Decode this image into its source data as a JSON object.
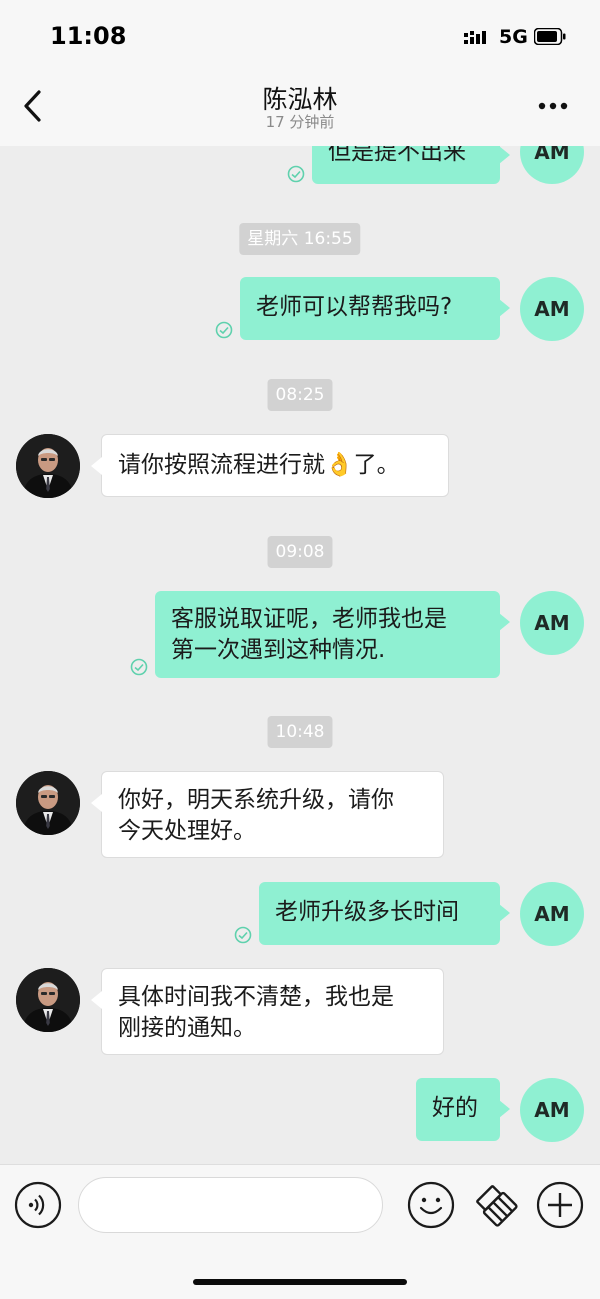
{
  "status_bar": {
    "time": "11:08",
    "network": "5G"
  },
  "header": {
    "title": "陈泓林",
    "subtitle": "17 分钟前"
  },
  "me_avatar_text": "AM",
  "messages": {
    "m0": "但是提不出来",
    "t1": "星期六 16:55",
    "m1": "老师可以帮帮我吗?",
    "t2": "08:25",
    "m2a": "请你按照流程进行就",
    "m2emoji": "👌",
    "m2b": "了。",
    "t3": "09:08",
    "m3l1": "客服说取证呢，老师我也是",
    "m3l2": "第一次遇到这种情况.",
    "t4": "10:48",
    "m4l1": "你好，明天系统升级，请你",
    "m4l2": "今天处理好。",
    "m5": "老师升级多长时间",
    "m6l1": "具体时间我不清楚，我也是",
    "m6l2": "刚接的通知。",
    "m7": "好的"
  },
  "input": {
    "value": "",
    "placeholder": ""
  },
  "colors": {
    "bubble_me": "#8ff0d2",
    "background": "#ededed",
    "read_check": "#5fd1ad"
  },
  "icons": [
    "back-icon",
    "more-icon",
    "voice-icon",
    "emoji-icon",
    "sticker-icon",
    "plus-icon",
    "read-check-icon"
  ]
}
